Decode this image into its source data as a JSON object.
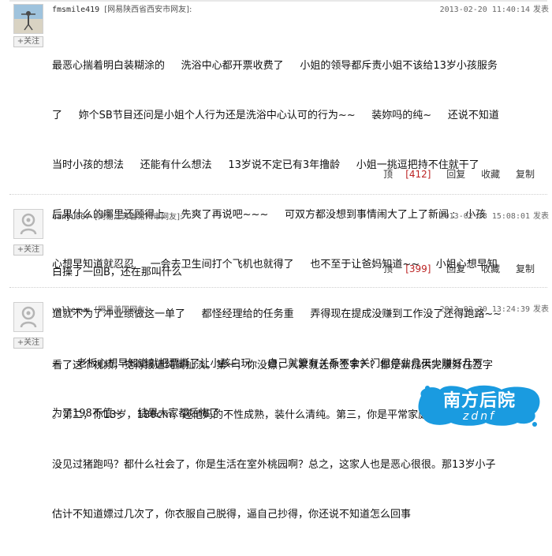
{
  "comments": [
    {
      "user": "fmsmile419",
      "location": "[网易陕西省西安市网友]:",
      "time": "2013-02-20 11:40:14",
      "reply_label": "发表",
      "follow_label": "+关注",
      "lines": [
        "最恶心揣着明白装糊涂的     洗浴中心都开票收费了     小姐的领导都斥责小姐不该给13岁小孩服务",
        "了     妳个SB节目还问是小姐个人行为还是洗浴中心认可的行为~~     装妳吗的纯~     还说不知道",
        "当时小孩的想法     还能有什么想法     13岁说不定已有3年撸龄     小姐一挑逗把持不住就干了",
        "后果什么的哪里还顾得上     先爽了再说吧~~~     可双方都没想到事情闹大了上了新闻 :   小孩",
        "心想早知道就忍忍     一会去卫生间打个飞机也就得了     也不至于让爸妈知道~~     小姐心想早知",
        "道就不为了冲业绩做这一单了     都怪经理给的任务重     弄得现在提成没赚到工作没了还得跑路~~",
        "~     老板心想早知道就把票撕了让小孩白玩     自己就算有关系不会关门但停业几天少赚好几万",
        "为了198不值~     结果大家都后悔了"
      ],
      "actions": {
        "top_label": "顶",
        "top_count": "[412]",
        "reply": "回复",
        "save": "收藏",
        "copy": "复制"
      }
    },
    {
      "user": "tanyu007",
      "location": "[网易江苏省常州市网友]:",
      "time": "2013-02-18 15:08:01",
      "reply_label": "发表",
      "follow_label": "+关注",
      "lines": [
        "白操了一回B，还在那叫什么"
      ],
      "actions": {
        "top_label": "顶",
        "top_count": "[399]",
        "reply": "回复",
        "save": "收藏",
        "copy": "复制"
      }
    },
    {
      "user": "vallenwu",
      "location": "[网易美国网友]:",
      "time": "2013-02-20 13:24:39",
      "reply_label": "发表",
      "follow_label": "+关注",
      "lines": [
        "看了这个视频，觉得报道纯属扯淡。第一，你没嫖，人家就让你签字？？都是新提供完服务在签字",
        "。第二，你13岁，180cm，还他妈的不性成熟，装什么清纯。第三，你是平常家庭？没见过猪肉还",
        "没见过猪跑吗？都什么社会了，你是生活在室外桃园啊？总之，这家人也是恶心很很。那13岁小子",
        "估计不知道嫖过几次了，你衣服自己脱得，逼自己抄得，你还说不知道怎么回事"
      ]
    }
  ],
  "watermark": {
    "main": "南方后院",
    "sub": "zdnf",
    "bg_color": "#1a9be0"
  }
}
